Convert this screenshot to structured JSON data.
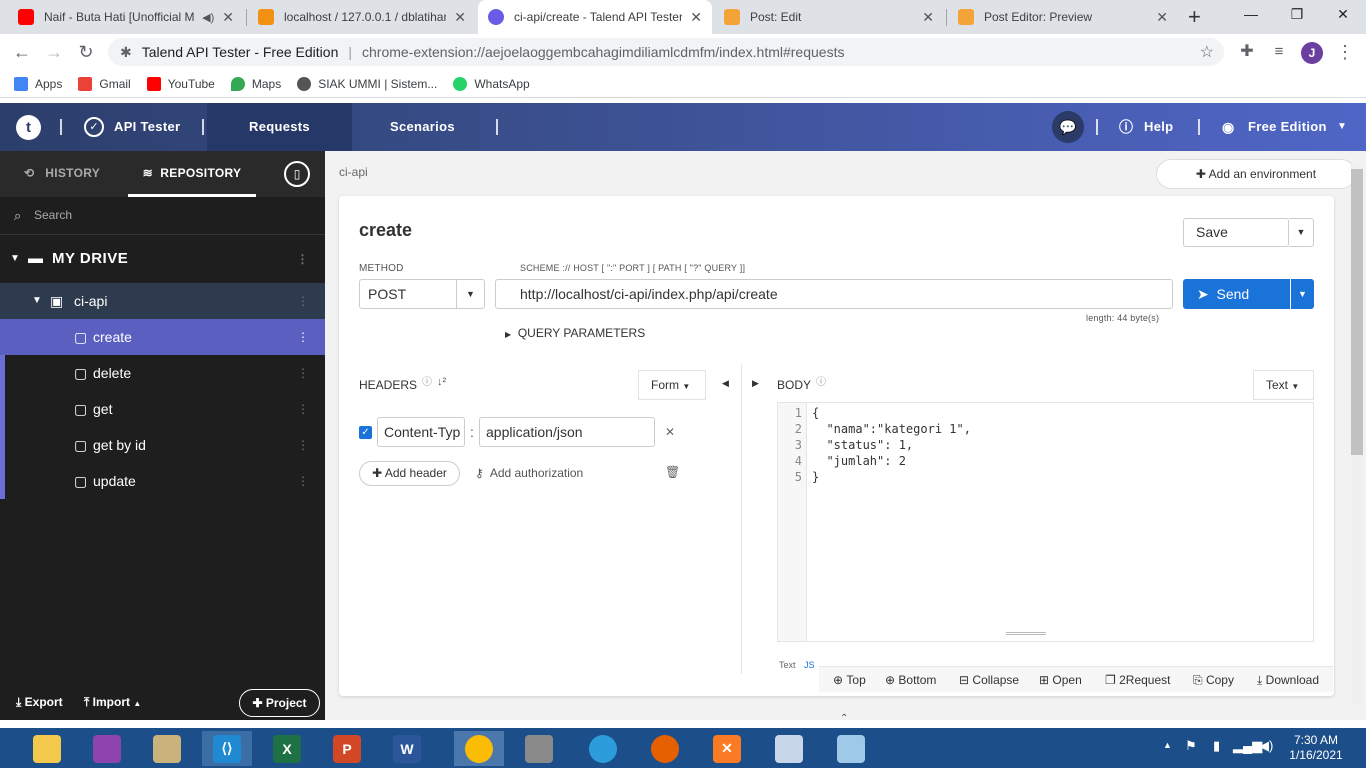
{
  "browser": {
    "tabs": [
      {
        "title": "Naif - Buta Hati [Unofficial M",
        "favicon_color": "#ff0000",
        "close": "✕"
      },
      {
        "title": "localhost / 127.0.0.1 / dblatihan",
        "favicon_color": "#f29111",
        "close": "✕"
      },
      {
        "title": "ci-api/create - Talend API Tester",
        "favicon_color": "#6b5ce7",
        "close": "✕"
      },
      {
        "title": "Post: Edit",
        "favicon_color": "#f4a338",
        "close": "✕"
      },
      {
        "title": "Post Editor: Preview",
        "favicon_color": "#f4a338",
        "close": "✕"
      }
    ],
    "new_tab": "+",
    "omnibox": {
      "site": "Talend API Tester - Free Edition",
      "separator": "|",
      "url": "chrome-extension://aejoelaoggembcahagimdiliamlcdmfm/index.html#requests"
    },
    "profile_initial": "J",
    "bookmarks": [
      {
        "label": "Apps",
        "color": "#4285f4"
      },
      {
        "label": "Gmail",
        "color": "#ea4335"
      },
      {
        "label": "YouTube",
        "color": "#ff0000"
      },
      {
        "label": "Maps",
        "color": "#34a853"
      },
      {
        "label": "SIAK UMMI | Sistem...",
        "color": "#555555"
      },
      {
        "label": "WhatsApp",
        "color": "#25d366"
      }
    ]
  },
  "app": {
    "logo": "t",
    "product": "API Tester",
    "nav": [
      "Requests",
      "Scenarios"
    ],
    "help": "Help",
    "edition": "Free Edition"
  },
  "sidebar": {
    "tabs": [
      "HISTORY",
      "REPOSITORY"
    ],
    "search_placeholder": "Search",
    "drive": "MY DRIVE",
    "project": "ci-api",
    "requests": [
      "create",
      "delete",
      "get",
      "get by id",
      "update"
    ],
    "export": "Export",
    "import": "Import",
    "project_btn": "Project"
  },
  "main": {
    "breadcrumb": "ci-api",
    "add_env": "Add an environment",
    "title": "create",
    "save": "Save",
    "method_label": "METHOD",
    "method": "POST",
    "scheme_label": "SCHEME :// HOST [ \":\" PORT ] [ PATH [ \"?\" QUERY ]]",
    "url": "http://localhost/ci-api/index.php/api/create",
    "url_length": "length: 44 byte(s)",
    "send": "Send",
    "query_params": "QUERY PARAMETERS",
    "headers_label": "HEADERS",
    "headers_mode": "Form",
    "header_key": "Content-Typ",
    "header_colon": ":",
    "header_value": "application/json",
    "add_header": "Add header",
    "add_auth": "Add authorization",
    "body_label": "BODY",
    "body_mode": "Text",
    "body_lines": [
      {
        "n": "1",
        "text": "{"
      },
      {
        "n": "2",
        "text": "  \"nama\":\"kategori 1\","
      },
      {
        "n": "3",
        "text": "  \"status\": 1,"
      },
      {
        "n": "4",
        "text": "  \"jumlah\": 2"
      },
      {
        "n": "5",
        "text": "}"
      }
    ],
    "body_footer": [
      "Text",
      "JS"
    ],
    "bottom_actions": [
      "Top",
      "Bottom",
      "Collapse",
      "Open",
      "2Request",
      "Copy",
      "Download"
    ]
  },
  "taskbar": {
    "time": "7:30 AM",
    "date": "1/16/2021"
  }
}
